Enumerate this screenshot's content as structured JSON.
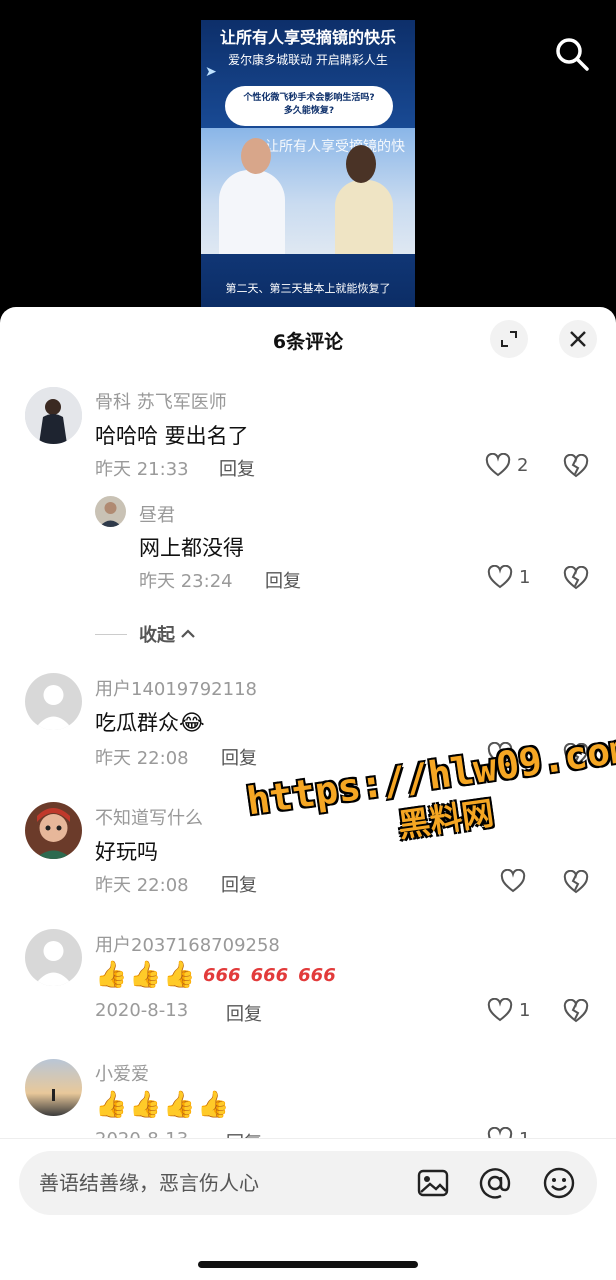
{
  "video": {
    "headline": "让所有人享受摘镜的快乐",
    "subline": "爱尔康多城联动  开启睛彩人生",
    "bubble": "个性化微飞秒手术会影响生活吗?\n多久能恢复?",
    "bg_text": "让所有人享受摘镜的快",
    "caption": "第二天、第三天基本上就能恢复了"
  },
  "sheet": {
    "title": "6条评论",
    "collapse_label": "收起"
  },
  "comments": [
    {
      "user": "骨科 苏飞军医师",
      "text": "哈哈哈  要出名了",
      "time": "昨天 21:33",
      "reply": "回复",
      "likes": "2"
    },
    {
      "user": "昼君",
      "text": "网上都没得",
      "time": "昨天 23:24",
      "reply": "回复",
      "likes": "1"
    },
    {
      "user": "用户14019792118",
      "text": "吃瓜群众",
      "time": "昨天 22:08",
      "reply": "回复",
      "likes": "1"
    },
    {
      "user": "不知道写什么",
      "text": "好玩吗",
      "time": "昨天 22:08",
      "reply": "回复",
      "likes": ""
    },
    {
      "user": "用户2037168709258",
      "text": "666",
      "time": "2020-8-13",
      "reply": "回复",
      "likes": "1"
    },
    {
      "user": "小爱爱",
      "text": "",
      "time": "2020-8-13",
      "reply": "回复",
      "likes": "1"
    }
  ],
  "watermark": {
    "line1": "https://hlw09.com",
    "line2": "黑料网"
  },
  "input": {
    "placeholder": "善语结善缘，恶言伤人心"
  },
  "colors": {
    "accent": "#f5a623",
    "sheet_bg": "#ffffff",
    "input_bg": "#f2f2f2"
  }
}
